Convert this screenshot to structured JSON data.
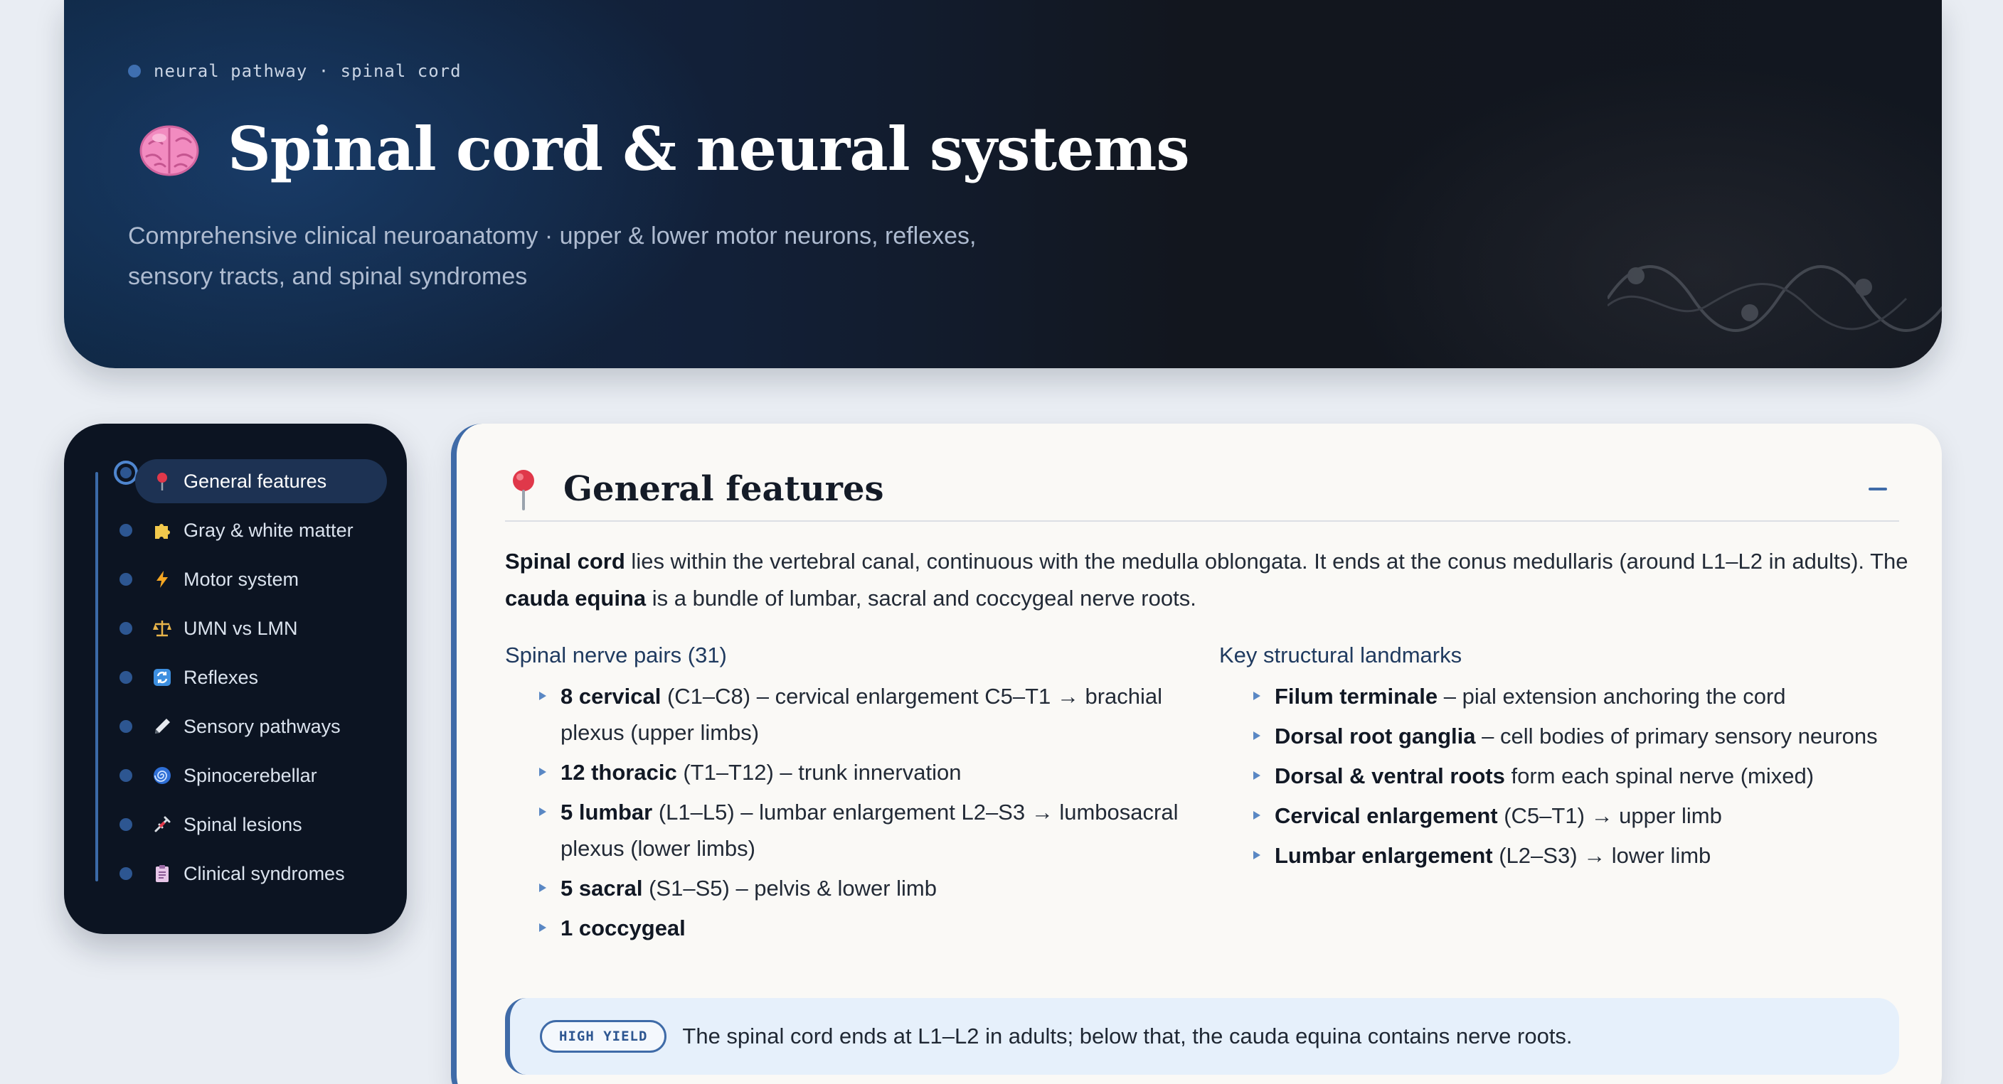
{
  "hero": {
    "breadcrumb": "neural pathway · spinal cord",
    "title": "Spinal cord & neural systems",
    "subtitle_line1": "Comprehensive clinical neuroanatomy · upper & lower motor neurons, reflexes,",
    "subtitle_line2": "sensory tracts, and spinal syndromes",
    "title_icon": "brain-icon"
  },
  "sidebar": {
    "items": [
      {
        "label": "General features",
        "icon": "pushpin-icon",
        "active": true
      },
      {
        "label": "Gray & white matter",
        "icon": "puzzle-icon",
        "active": false
      },
      {
        "label": "Motor system",
        "icon": "lightning-icon",
        "active": false
      },
      {
        "label": "UMN vs LMN",
        "icon": "scales-icon",
        "active": false
      },
      {
        "label": "Reflexes",
        "icon": "cycle-icon",
        "active": false
      },
      {
        "label": "Sensory pathways",
        "icon": "pen-icon",
        "active": false
      },
      {
        "label": "Spinocerebellar",
        "icon": "spiral-icon",
        "active": false
      },
      {
        "label": "Spinal lesions",
        "icon": "syringe-icon",
        "active": false
      },
      {
        "label": "Clinical syndromes",
        "icon": "clipboard-icon",
        "active": false
      }
    ]
  },
  "section": {
    "title": "General features",
    "icon": "pushpin-icon",
    "intro": {
      "t1": "Spinal cord",
      "t2": " lies within the vertebral canal, continuous with the medulla oblongata. It ends at the conus medullaris (around L1–L2 in adults). The ",
      "t3": "cauda equina",
      "t4": " is a bundle of lumbar, sacral and coccygeal nerve roots."
    },
    "left_column": {
      "heading": "Spinal nerve pairs (31)",
      "items": [
        {
          "bold": "8 cervical",
          "text": " (C1–C8) – cervical enlargement C5–T1 → brachial plexus (upper limbs)"
        },
        {
          "bold": "12 thoracic",
          "text": " (T1–T12) – trunk innervation"
        },
        {
          "bold": "5 lumbar",
          "text": " (L1–L5) – lumbar enlargement L2–S3 → lumbosacral plexus (lower limbs)"
        },
        {
          "bold": "5 sacral",
          "text": " (S1–S5) – pelvis & lower limb"
        },
        {
          "bold": "1 coccygeal",
          "text": ""
        }
      ]
    },
    "right_column": {
      "heading": "Key structural landmarks",
      "items": [
        {
          "bold": "Filum terminale",
          "text": " – pial extension anchoring the cord"
        },
        {
          "bold": "Dorsal root ganglia",
          "text": " – cell bodies of primary sensory neurons"
        },
        {
          "bold": "Dorsal & ventral roots",
          "text": " form each spinal nerve (mixed)"
        },
        {
          "bold": "Cervical enlargement",
          "text": " (C5–T1) → upper limb"
        },
        {
          "bold": "Lumbar enlargement",
          "text": " (L2–S3) → lower limb"
        }
      ]
    },
    "callout": {
      "badge": "HIGH YIELD",
      "text": "The spinal cord ends at L1–L2 in adults; below that, the cauda equina contains nerve roots."
    }
  },
  "colors": {
    "accent": "#3f6ba8",
    "sidebar_bg": "#0c1422",
    "card_bg": "#faf9f6",
    "callout_bg": "#e6f0fb"
  }
}
